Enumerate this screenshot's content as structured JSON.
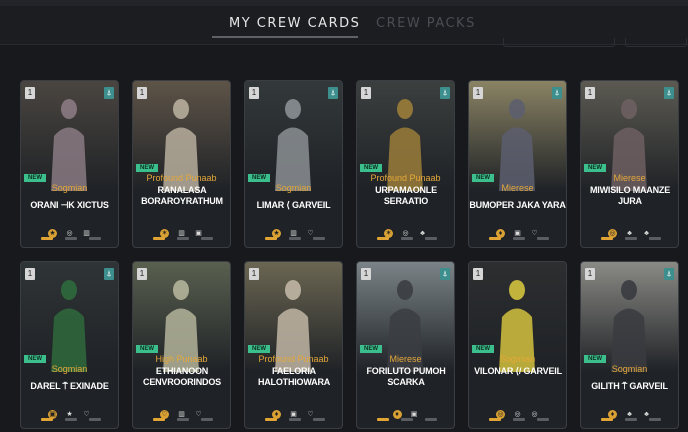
{
  "tabs": {
    "active": "MY CREW CARDS",
    "inactive": "CREW PACKS"
  },
  "cards": [
    {
      "num": "1",
      "flag": "⍋",
      "new": "NEW",
      "species": "Sogmian",
      "name": "ORANI ⊣K XICTUS",
      "icons": [
        "★",
        "◎",
        "▥"
      ],
      "bg": "#4a4540",
      "fig": "#8a7a82"
    },
    {
      "num": "1",
      "flag": "",
      "new": "NEW",
      "species": "Profound Punaab",
      "name": "RANALASA BORAROYRATHUM",
      "icons": [
        "✶",
        "▥",
        "▣"
      ],
      "bg": "#5e5448",
      "fig": "#b7ae9c"
    },
    {
      "num": "1",
      "flag": "⍋",
      "new": "NEW",
      "species": "Sogmian",
      "name": "LIMAR ⟨ GARVEIL",
      "icons": [
        "★",
        "▥",
        "♡"
      ],
      "bg": "#33393a",
      "fig": "#8b8f93"
    },
    {
      "num": "1",
      "flag": "⍋",
      "new": "NEW",
      "species": "Profound Punaab",
      "name": "URPAMAONLE SERAATIO",
      "icons": [
        "✶",
        "◎",
        "♣"
      ],
      "bg": "#3b3f3e",
      "fig": "#9a7d3a"
    },
    {
      "num": "1",
      "flag": "⍋",
      "new": "NEW",
      "species": "Mierese",
      "name": "BUMOPER JAKA YARA",
      "icons": [
        "♦",
        "▣",
        "♡"
      ],
      "bg": "#8a8364",
      "fig": "#5c5e6e"
    },
    {
      "num": "1",
      "flag": "⍋",
      "new": "NEW",
      "species": "Mierese",
      "name": "MIWISILO MAANZE JURA",
      "icons": [
        "◎",
        "♣",
        "♣"
      ],
      "bg": "#5c5a52",
      "fig": "#6e5f62"
    },
    {
      "num": "1",
      "flag": "⍋",
      "new": "NEW",
      "species": "Sogmian",
      "name": "DAREL ⍑ EXINADE",
      "icons": [
        "▣",
        "★",
        "♡"
      ],
      "bg": "#2f3436",
      "fig": "#2f6a3c"
    },
    {
      "num": "1",
      "flag": "",
      "new": "NEW",
      "species": "High Punaab",
      "name": "ETHIANOON CENVROORINDOS",
      "icons": [
        "♡",
        "▥",
        "♡"
      ],
      "bg": "#59604f",
      "fig": "#b4b49a"
    },
    {
      "num": "1",
      "flag": "",
      "new": "NEW",
      "species": "Profound Punaab",
      "name": "FAELORIA HALOTHIOWARA",
      "icons": [
        "♦",
        "▣",
        "♡"
      ],
      "bg": "#6b6652",
      "fig": "#c1b6a4"
    },
    {
      "num": "1",
      "flag": "⍋",
      "new": "NEW",
      "species": "Mierese",
      "name": "FORILUTO PUMOH SCARKA",
      "icons": [
        "♦",
        "▣"
      ],
      "bg": "#7a8387",
      "fig": "#3b3d42"
    },
    {
      "num": "1",
      "flag": "",
      "new": "NEW",
      "species": "Sogmian",
      "name": "VILONAR ⟨/ GARVEIL",
      "icons": [
        "◎",
        "◎",
        "◎"
      ],
      "bg": "#2c2e30",
      "fig": "#d3c23e"
    },
    {
      "num": "1",
      "flag": "⍋",
      "new": "NEW",
      "species": "Sogmian",
      "name": "GILITH ⍑ GARVEIL",
      "icons": [
        "♦",
        "♣",
        "♣"
      ],
      "bg": "#8a8a85",
      "fig": "#3a3b40"
    }
  ]
}
